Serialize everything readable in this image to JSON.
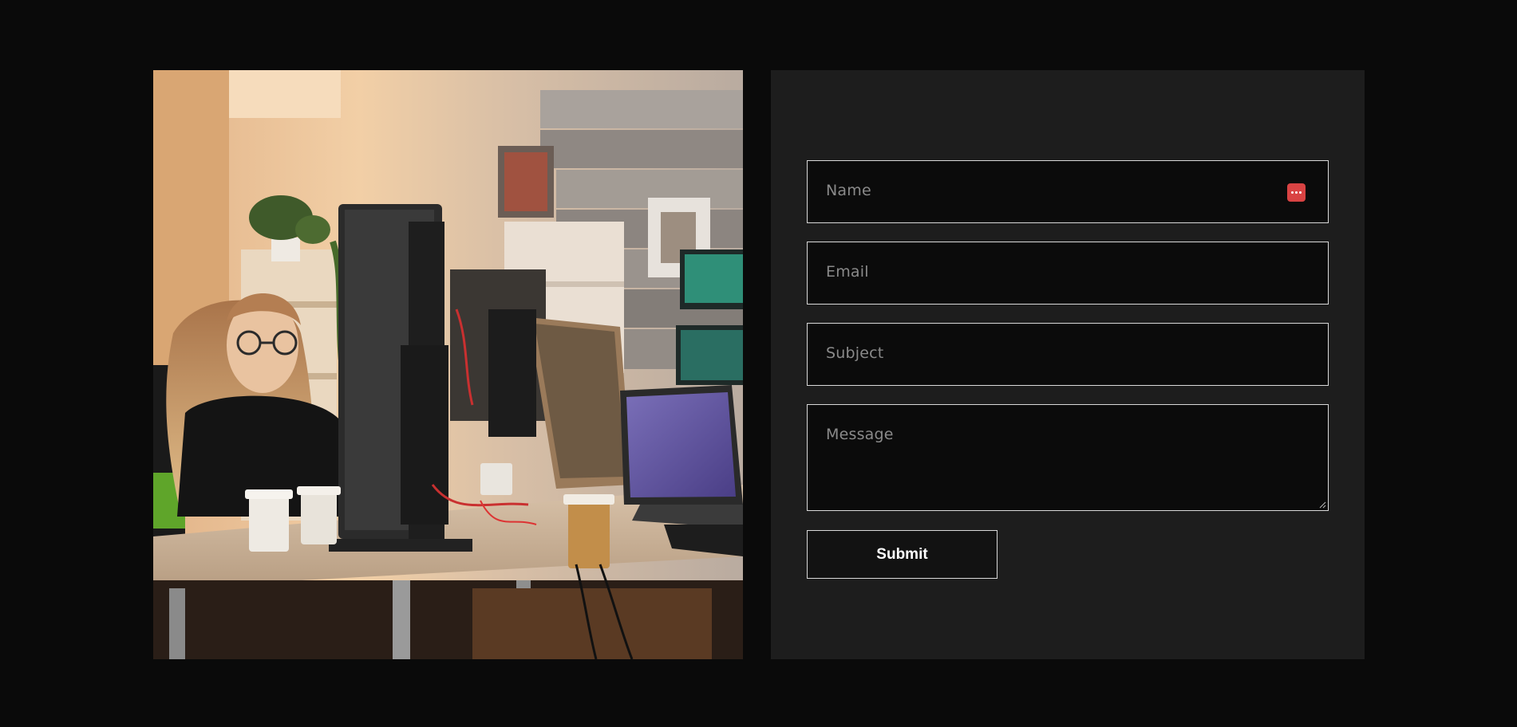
{
  "photo": {
    "icon": "office-photo-woman-at-computers"
  },
  "contact_form": {
    "name_placeholder": "Name",
    "email_placeholder": "Email",
    "subject_placeholder": "Subject",
    "message_placeholder": "Message",
    "submit_label": "Submit",
    "password_manager_icon": "password-manager-icon",
    "colors": {
      "page_background": "#0a0a0a",
      "panel_background": "#1d1d1d",
      "field_background": "#0b0b0b",
      "field_border": "#d9d9d9",
      "placeholder_text": "#8a8a8a",
      "badge_red": "#d94343"
    }
  }
}
